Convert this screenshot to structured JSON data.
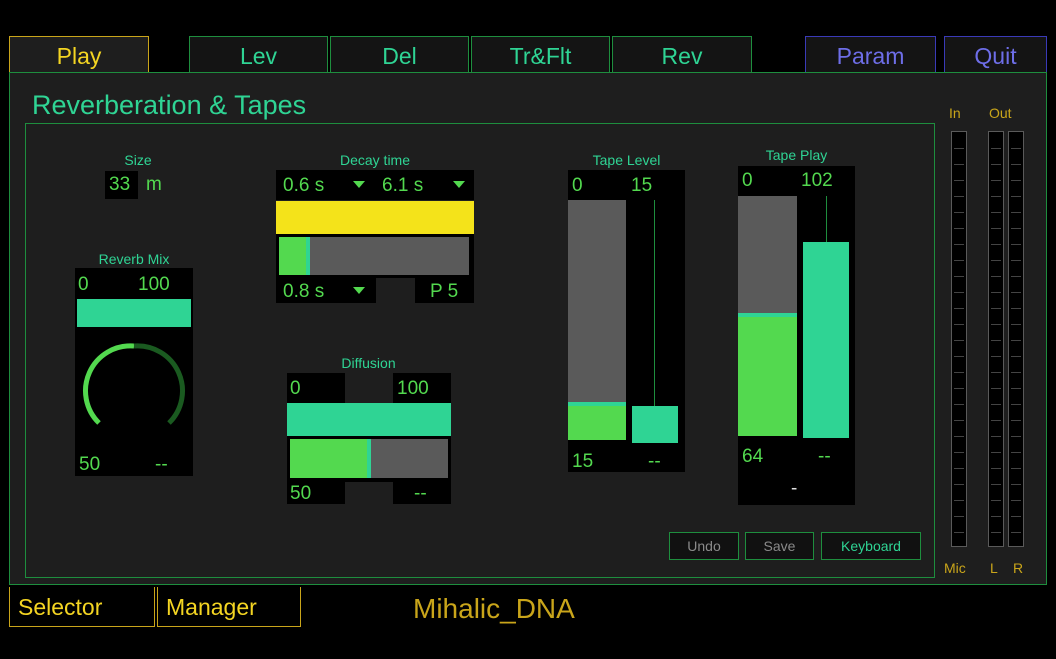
{
  "tabs": {
    "play": "Play",
    "lev": "Lev",
    "del": "Del",
    "trflt": "Tr&Flt",
    "rev": "Rev",
    "param": "Param",
    "quit": "Quit"
  },
  "panel_title": "Reverberation & Tapes",
  "size": {
    "label": "Size",
    "value": "33",
    "unit": "m"
  },
  "reverb_mix": {
    "label": "Reverb Mix",
    "min": "0",
    "max": "100",
    "value": "50",
    "aux": "--",
    "knob_fraction": 0.5
  },
  "decay_time": {
    "label": "Decay time",
    "low": "0.6 s",
    "high": "6.1 s",
    "current": "0.8 s",
    "preset": "P 5",
    "fraction": 0.04
  },
  "diffusion": {
    "label": "Diffusion",
    "min": "0",
    "max": "100",
    "value": "50",
    "aux": "--",
    "fraction": 0.5
  },
  "tape_level": {
    "label": "Tape Level",
    "min": "0",
    "max": "15",
    "value": "15",
    "aux": "--"
  },
  "tape_play": {
    "label": "Tape Play",
    "min": "0",
    "max": "102",
    "value": "64",
    "aux": "--",
    "dash": "-"
  },
  "buttons": {
    "undo": "Undo",
    "save": "Save",
    "keyboard": "Keyboard"
  },
  "meters": {
    "in_label": "In",
    "out_label": "Out",
    "mic_label": "Mic",
    "l_label": "L",
    "r_label": "R"
  },
  "bottom": {
    "selector": "Selector",
    "manager": "Manager",
    "preset_name": "Mihalic_DNA"
  },
  "colors": {
    "teal": "#2fd494",
    "green": "#53d94f",
    "yellow": "#f4d522",
    "blue": "#6e6ee8",
    "border": "#1e8e3e"
  }
}
